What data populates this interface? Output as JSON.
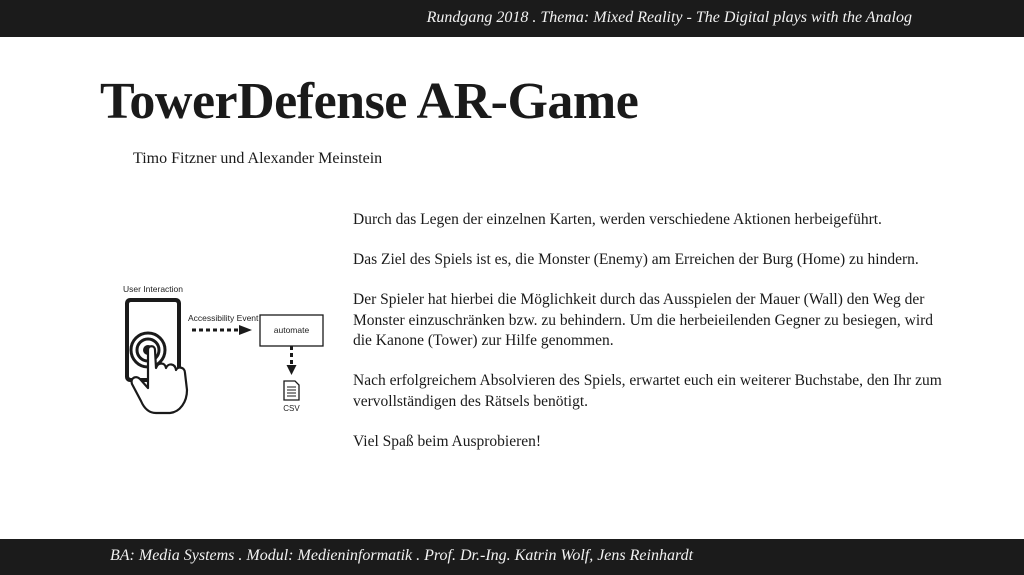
{
  "header": {
    "text": "Rundgang 2018 . Thema: Mixed Reality - The Digital plays with the Analog"
  },
  "title": "TowerDefense AR-Game",
  "authors": "Timo Fitzner und Alexander Meinstein",
  "paragraphs": [
    "Durch das Legen der einzelnen Karten, werden verschiedene Aktionen herbeigeführt.",
    "Das Ziel des Spiels ist es, die Monster (Enemy) am Erreichen der Burg (Home) zu hindern.",
    "Der Spieler hat hierbei die Möglichkeit durch das Ausspielen der Mauer (Wall) den Weg der Monster einzuschränken bzw. zu behindern. Um die herbeieilenden Gegner zu besiegen, wird die Kanone (Tower) zur Hilfe genommen.",
    "Nach erfolgreichem Absolvieren des Spiels, erwartet euch ein weiterer Buchstabe, den Ihr zum vervollständigen des Rätsels benötigt.",
    "Viel Spaß beim Ausprobieren!"
  ],
  "diagram": {
    "user_interaction_label": "User Interaction",
    "event_label": "Accessibility Event",
    "box_label": "automate",
    "output_label": "CSV",
    "icons": [
      "phone-touch-icon",
      "hand-pointer-icon",
      "document-icon"
    ]
  },
  "footer": {
    "text": "BA: Media Systems . Modul: Medieninformatik . Prof. Dr.-Ing. Katrin Wolf, Jens Reinhardt"
  }
}
